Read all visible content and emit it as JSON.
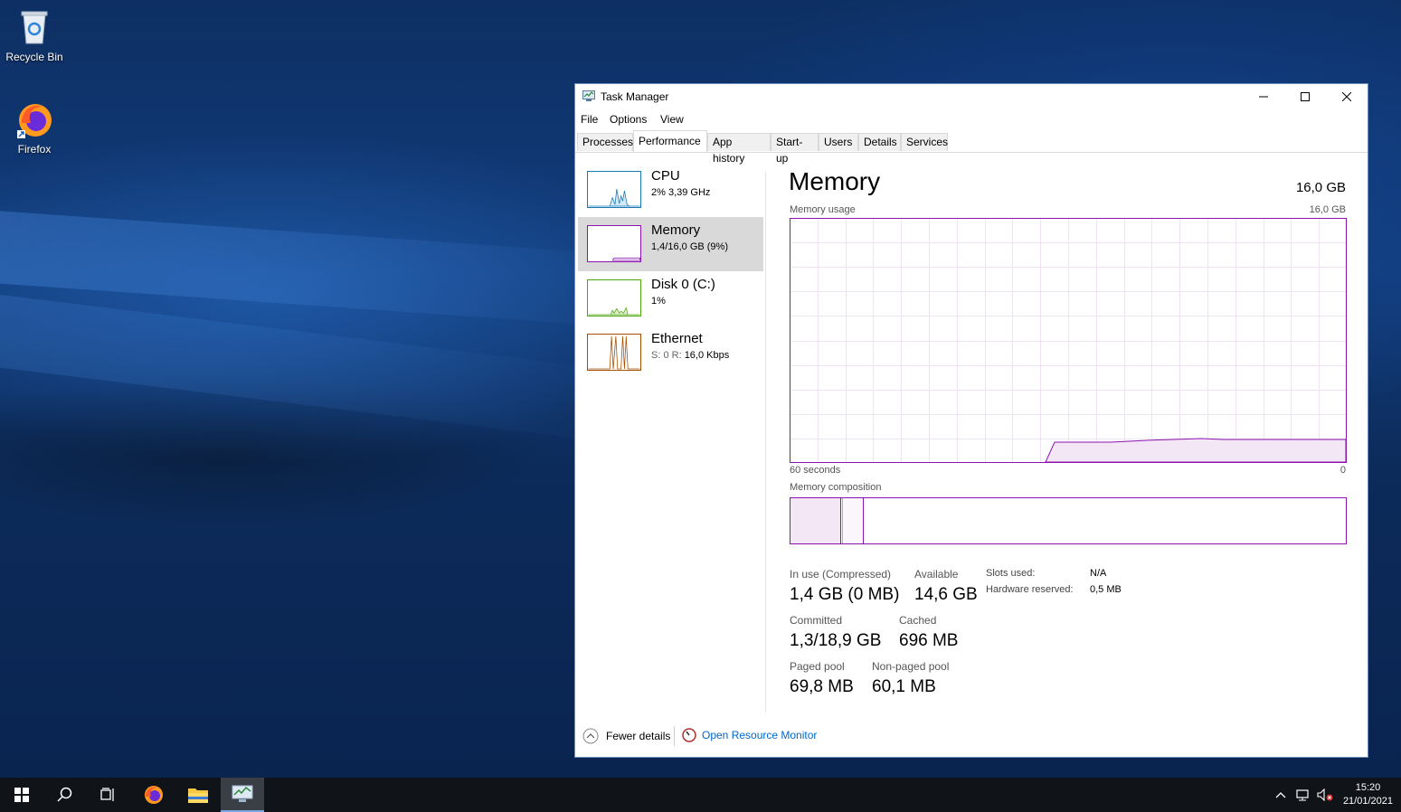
{
  "desktop": {
    "icons": [
      {
        "label": "Recycle Bin",
        "icon": "recycle-bin-icon"
      },
      {
        "label": "Firefox",
        "icon": "firefox-icon"
      }
    ]
  },
  "window": {
    "title": "Task Manager",
    "menu": [
      "File",
      "Options",
      "View"
    ],
    "tabs": [
      "Processes",
      "Performance",
      "App history",
      "Start-up",
      "Users",
      "Details",
      "Services"
    ],
    "active_tab": "Performance"
  },
  "sidebar": {
    "items": [
      {
        "title": "CPU",
        "sub": "2%  3,39 GHz",
        "color": "#1778b5"
      },
      {
        "title": "Memory",
        "sub": "1,4/16,0 GB (9%)",
        "color": "#8b12ae"
      },
      {
        "title": "Disk 0 (C:)",
        "sub": "1%",
        "color": "#4da60c"
      },
      {
        "title": "Ethernet",
        "sub_prefix": "S: 0  R:",
        "sub": "16,0 Kbps",
        "color": "#a74f01"
      }
    ]
  },
  "memory": {
    "title": "Memory",
    "total": "16,0 GB",
    "usage_label": "Memory usage",
    "usage_max": "16,0 GB",
    "time_left": "60 seconds",
    "time_right": "0",
    "composition_label": "Memory composition",
    "stats": {
      "in_use_label": "In use (Compressed)",
      "in_use_value": "1,4 GB (0 MB)",
      "available_label": "Available",
      "available_value": "14,6 GB",
      "committed_label": "Committed",
      "committed_value": "1,3/18,9 GB",
      "cached_label": "Cached",
      "cached_value": "696 MB",
      "paged_label": "Paged pool",
      "paged_value": "69,8 MB",
      "nonpaged_label": "Non-paged pool",
      "nonpaged_value": "60,1 MB",
      "slots_label": "Slots used:",
      "slots_value": "N/A",
      "hw_label": "Hardware reserved:",
      "hw_value": "0,5 MB"
    },
    "usage_fraction": 0.09
  },
  "footer": {
    "fewer": "Fewer details",
    "resmon": "Open Resource Monitor"
  },
  "taskbar": {
    "time": "15:20",
    "date": "21/01/2021"
  },
  "colors": {
    "memory": "#8b12ae",
    "cpu": "#1778b5",
    "disk": "#4da60c",
    "ethernet": "#a74f01",
    "link": "#0066cc"
  }
}
